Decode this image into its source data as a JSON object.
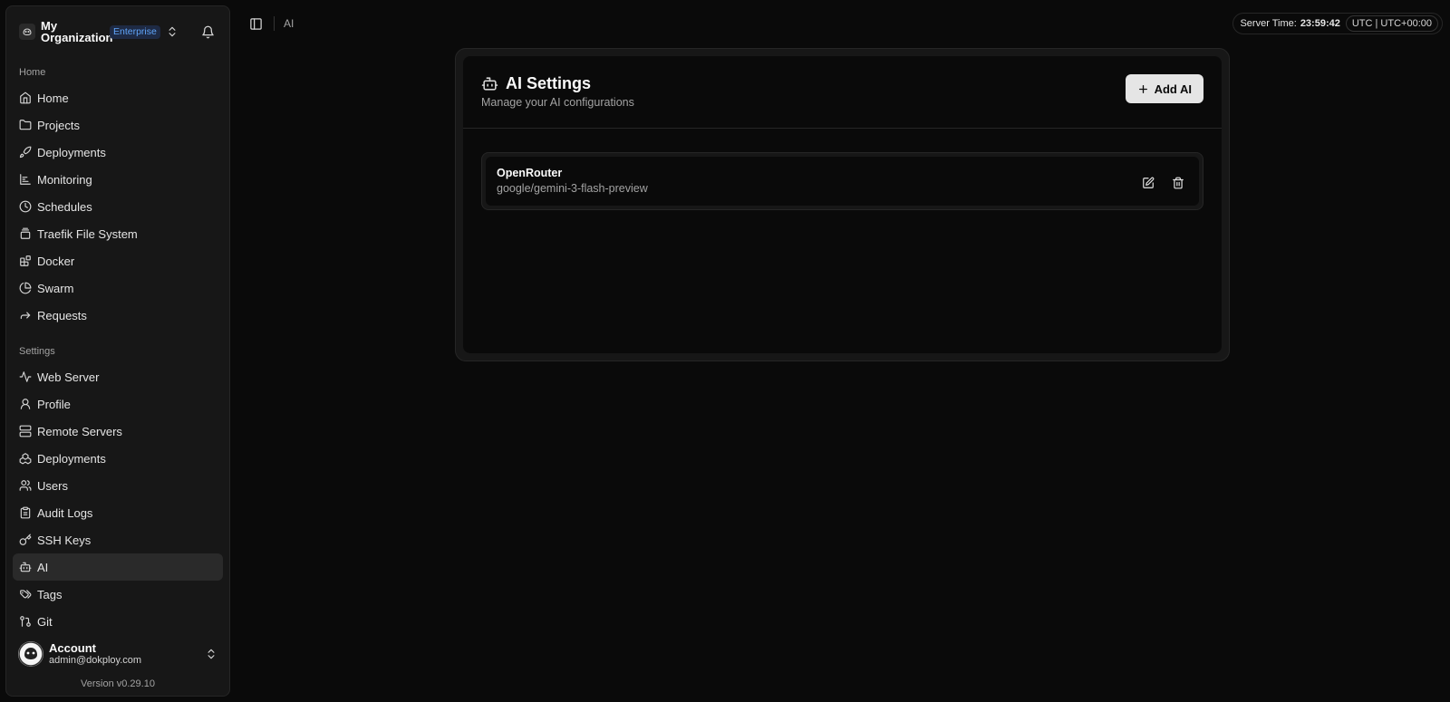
{
  "org": {
    "name": "My Organization",
    "plan_badge": "Enterprise"
  },
  "nav_home": {
    "label": "Home",
    "items": [
      {
        "label": "Home",
        "icon": "home-icon"
      },
      {
        "label": "Projects",
        "icon": "folder-icon"
      },
      {
        "label": "Deployments",
        "icon": "rocket-icon"
      },
      {
        "label": "Monitoring",
        "icon": "chart-icon"
      },
      {
        "label": "Schedules",
        "icon": "clock-icon"
      },
      {
        "label": "Traefik File System",
        "icon": "layers-icon"
      },
      {
        "label": "Docker",
        "icon": "blocks-icon"
      },
      {
        "label": "Swarm",
        "icon": "pie-icon"
      },
      {
        "label": "Requests",
        "icon": "forward-icon"
      }
    ]
  },
  "nav_settings": {
    "label": "Settings",
    "items": [
      {
        "label": "Web Server",
        "icon": "activity-icon"
      },
      {
        "label": "Profile",
        "icon": "user-icon"
      },
      {
        "label": "Remote Servers",
        "icon": "server-icon"
      },
      {
        "label": "Deployments",
        "icon": "boxes-icon"
      },
      {
        "label": "Users",
        "icon": "users-icon"
      },
      {
        "label": "Audit Logs",
        "icon": "clipboard-icon"
      },
      {
        "label": "SSH Keys",
        "icon": "key-icon"
      },
      {
        "label": "AI",
        "icon": "bot-icon",
        "active": true
      },
      {
        "label": "Tags",
        "icon": "tags-icon"
      },
      {
        "label": "Git",
        "icon": "git-icon"
      }
    ]
  },
  "account": {
    "name": "Account",
    "email": "admin@dokploy.com"
  },
  "version": "Version v0.29.10",
  "breadcrumb": "AI",
  "server_time": {
    "label": "Server Time:",
    "value": "23:59:42",
    "timezone": "UTC | UTC+00:00"
  },
  "page": {
    "title": "AI Settings",
    "subtitle": "Manage your AI configurations",
    "add_button": "Add AI"
  },
  "ai_configs": [
    {
      "provider": "OpenRouter",
      "model": "google/gemini-3-flash-preview"
    }
  ]
}
